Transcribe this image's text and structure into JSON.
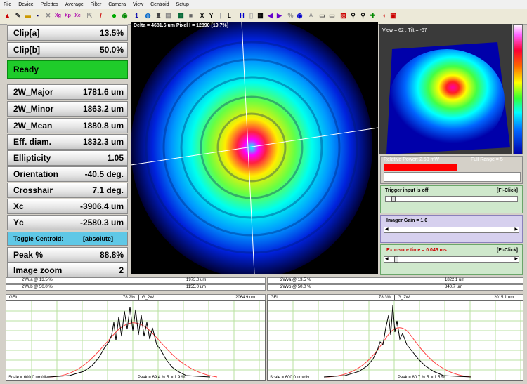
{
  "menu": [
    "File",
    "Device",
    "Palettes",
    "Average",
    "Filter",
    "Camera",
    "View",
    "Centroid",
    "Setup"
  ],
  "status_top": "Delta = 4681.6 um Pixel I = 12890 [19.7%]",
  "left_rows": [
    {
      "label": "Clip[a]",
      "value": "13.5%"
    },
    {
      "label": "Clip[b]",
      "value": "50.0%"
    },
    {
      "label": "Ready",
      "value": ""
    },
    {
      "label": "2W_Major",
      "value": "1781.6 um"
    },
    {
      "label": "2W_Minor",
      "value": "1863.2 um"
    },
    {
      "label": "2W_Mean",
      "value": "1880.8 um"
    },
    {
      "label": "Eff. diam.",
      "value": "1832.3 um"
    },
    {
      "label": "Ellipticity",
      "value": "1.05"
    },
    {
      "label": "Orientation",
      "value": "-40.5 deg."
    },
    {
      "label": "Crosshair",
      "value": "7.1 deg."
    },
    {
      "label": "Xc",
      "value": "-3906.4 um"
    },
    {
      "label": "Yc",
      "value": "-2580.3 um"
    },
    {
      "label": "Toggle Centroid:",
      "value": "[absolute]"
    },
    {
      "label": "Peak %",
      "value": "88.8%"
    },
    {
      "label": "Image zoom",
      "value": "2"
    }
  ],
  "view3d": {
    "label": "View = 62 : Tilt = -67"
  },
  "power": {
    "relative": "Relative Power: 2.58 mW",
    "range": "Full Range = 5"
  },
  "trigger": {
    "text": "Trigger input is off.",
    "click": "[Fl-Click]"
  },
  "imager": {
    "text": "Imager Gain = 1.0"
  },
  "exposure": {
    "text": "Exposure time = 0.043 ms",
    "click": "[Fl-Click]"
  },
  "stats_left": [
    {
      "label": "2Wua @ 13.5 %",
      "value": "1973.0 um"
    },
    {
      "label": "2Wub @ 50.0 %",
      "value": "1155.0 um"
    }
  ],
  "stats_right": [
    {
      "label": "2Wva @ 13.5 %",
      "value": "1822.1 um"
    },
    {
      "label": "2Wvb @ 50.0 %",
      "value": "840.7 um"
    }
  ],
  "plot_left": {
    "gfit": "GFit",
    "gfit_value": "78.2%",
    "g2w": "G_2W",
    "g2w_value": "2064.9 um",
    "scale": "Scale = 600.0 um/div",
    "peak": "Peak = 69.4 %  R = 1.9 %"
  },
  "plot_right": {
    "gfit": "GFit",
    "gfit_value": "78.3%",
    "g2w": "G_2W",
    "g2w_value": "2015.1 um",
    "scale": "Scale = 600.0 um/div",
    "peak": "Peak = 80.7 %  R = 1.5 %"
  },
  "colors": {
    "ready": "#1fcc2a",
    "toggle": "#5fc8e6",
    "power_bar": "#ff0000",
    "green_panel": "#cfe8cc",
    "purple_panel": "#d6d0ee"
  }
}
